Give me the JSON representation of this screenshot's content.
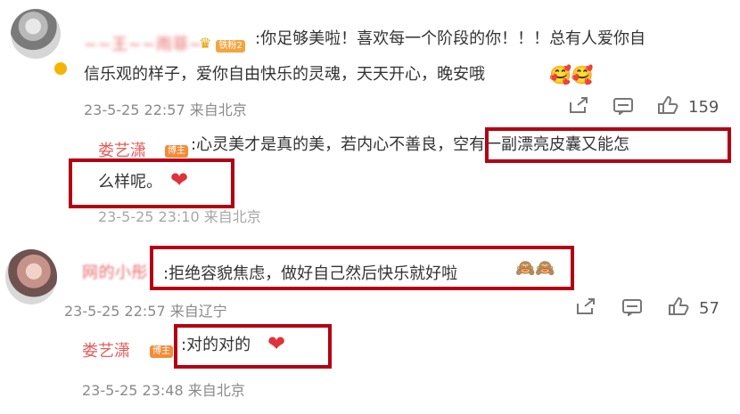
{
  "comment1": {
    "user_name": "~~王~~雨菲~",
    "badge": "铁粉2",
    "line1": ":你足够美啦！喜欢每一个阶段的你！！！总有人爱你自",
    "line2": "信乐观的样子，爱你自由快乐的灵魂，天天开心，晚安哦",
    "emoji": "🥰🥰",
    "timestamp": "23-5-25 22:57 来自北京",
    "likes": "159"
  },
  "reply1": {
    "author_name": "娄艺潇",
    "author_badge": "博主",
    "line1": ":心灵美才是真的美，若内心不善良，空有一副漂亮皮囊又能怎",
    "line2": "么样呢。",
    "heart": "❤",
    "timestamp": "23-5-25 23:10 来自北京"
  },
  "comment2": {
    "user_name": "网的小彤",
    "text": ":拒绝容貌焦虑，做好自己然后快乐就好啦",
    "emoji": "🙈🙈",
    "timestamp": "23-5-25 22:57 来自辽宁",
    "likes": "57"
  },
  "reply2": {
    "author_name": "娄艺潇",
    "author_badge": "博主",
    "text": ":对的对的",
    "heart": "❤",
    "timestamp": "23-5-25 23:48 来自北京"
  },
  "icons": {
    "share": "share-icon",
    "comment": "comment-icon",
    "like": "thumbs-up-icon",
    "verified": "verified-icon",
    "crown": "crown-icon"
  },
  "colors": {
    "name_red": "#e35d5b",
    "box_red": "#b30013",
    "meta_gray": "#8a8a8a"
  }
}
